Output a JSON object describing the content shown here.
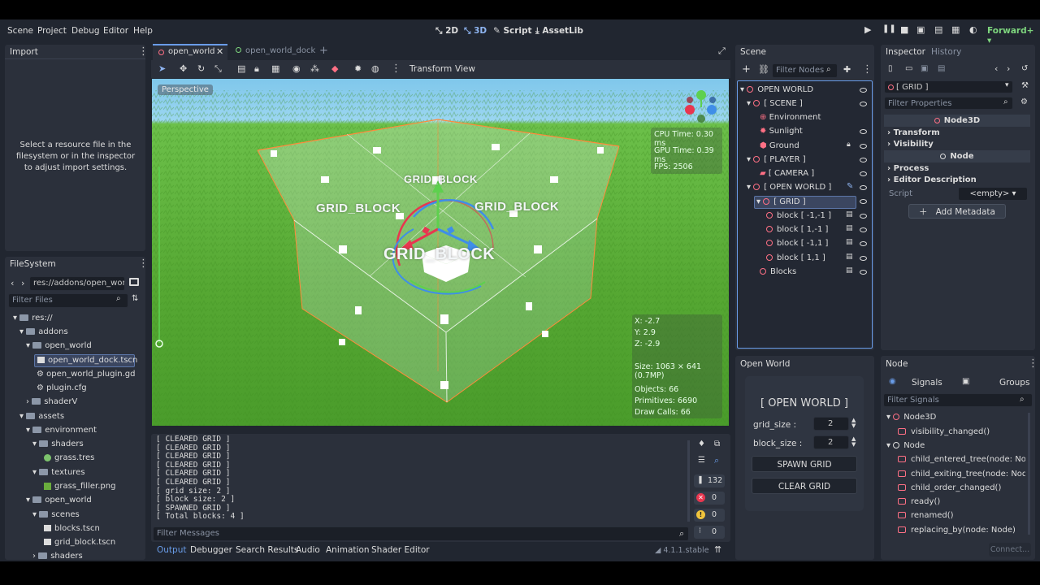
{
  "menu": [
    "Scene",
    "Project",
    "Debug",
    "Editor",
    "Help"
  ],
  "modes": {
    "m2d": "2D",
    "m3d": "3D",
    "script": "Script",
    "assetlib": "AssetLib"
  },
  "renderer": "Forward+",
  "import_panel": {
    "title": "Import",
    "message": "Select a resource file in the filesystem or in the inspector to adjust import settings."
  },
  "filesystem": {
    "title": "FileSystem",
    "path": "res://addons/open_world",
    "filter_placeholder": "Filter Files",
    "items": [
      "res://",
      "addons",
      "open_world",
      "open_world_dock.tscn",
      "open_world_plugin.gd",
      "plugin.cfg",
      "shaderV",
      "assets",
      "environment",
      "shaders",
      "grass.tres",
      "textures",
      "grass_filler.png",
      "open_world",
      "scenes",
      "blocks.tscn",
      "grid_block.tscn",
      "shaders"
    ]
  },
  "tabs": {
    "tab1": "open_world",
    "tab2": "open_world_dock"
  },
  "viewport_toolbar": {
    "transform": "Transform",
    "view": "View"
  },
  "viewport": {
    "perspective": "Perspective",
    "cpu": "CPU Time: 0.30 ms",
    "gpu": "GPU Time: 0.39 ms",
    "fps": "FPS: 2506",
    "labels": [
      "GRID_BLOCK",
      "GRID_BLOCK",
      "GRID_BLOCK",
      "GRID_BLOCK"
    ],
    "info": {
      "x": "X: -2.7",
      "y": "Y: 2.9",
      "z": "Z: -2.9",
      "size": "Size: 1063 × 641 (0.7MP)",
      "objects": "Objects: 66",
      "primitives": "Primitives: 6690",
      "drawcalls": "Draw Calls: 66"
    }
  },
  "output": {
    "lines": "[ CLEARED GRID ]\n[ CLEARED GRID ]\n[ CLEARED GRID ]\n[ CLEARED GRID ]\n[ CLEARED GRID ]\n[ CLEARED GRID ]\n[ grid size: 2 ]\n[ block size: 2 ]\n[ SPAWNED GRID ]\n[ Total blocks: 4 ]",
    "filter_placeholder": "Filter Messages",
    "counts": {
      "log": "132",
      "err": "0",
      "warn": "0",
      "info": "0"
    }
  },
  "bottom_tabs": [
    "Output",
    "Debugger",
    "Search Results",
    "Audio",
    "Animation",
    "Shader Editor"
  ],
  "version": "4.1.1.stable",
  "scene": {
    "title": "Scene",
    "filter_placeholder": "Filter Nodes",
    "nodes": [
      "OPEN WORLD",
      "[ SCENE ]",
      "Environment",
      "Sunlight",
      "Ground",
      "[ PLAYER ]",
      "[ CAMERA ]",
      "[ OPEN WORLD ]",
      "[ GRID ]",
      "block [ -1,-1 ]",
      "block [ 1,-1 ]",
      "block [ -1,1 ]",
      "block [ 1,1 ]",
      "Blocks"
    ]
  },
  "dock": {
    "title": "Open World",
    "heading": "[ OPEN WORLD ]",
    "grid_size_label": "grid_size :",
    "grid_size": "2",
    "block_size_label": "block_size :",
    "block_size": "2",
    "spawn": "SPAWN GRID",
    "clear": "CLEAR GRID"
  },
  "inspector": {
    "tab1": "Inspector",
    "tab2": "History",
    "selected": "[ GRID ]",
    "filter_placeholder": "Filter Properties",
    "class1": "Node3D",
    "transform": "Transform",
    "visibility": "Visibility",
    "class2": "Node",
    "process": "Process",
    "editor_desc": "Editor Description",
    "script_label": "Script",
    "script_value": "<empty>",
    "add_meta": "Add Metadata"
  },
  "node_panel": {
    "title": "Node",
    "signals": "Signals",
    "groups": "Groups",
    "filter_placeholder": "Filter Signals",
    "items": [
      "Node3D",
      "visibility_changed()",
      "Node",
      "child_entered_tree(node: Node)",
      "child_exiting_tree(node: Node)",
      "child_order_changed()",
      "ready()",
      "renamed()",
      "replacing_by(node: Node)"
    ],
    "connect": "Connect..."
  },
  "colors": {
    "accent": "#699ce8",
    "node": "#ff7085",
    "bg": "#212630",
    "panel": "#2b303b"
  }
}
